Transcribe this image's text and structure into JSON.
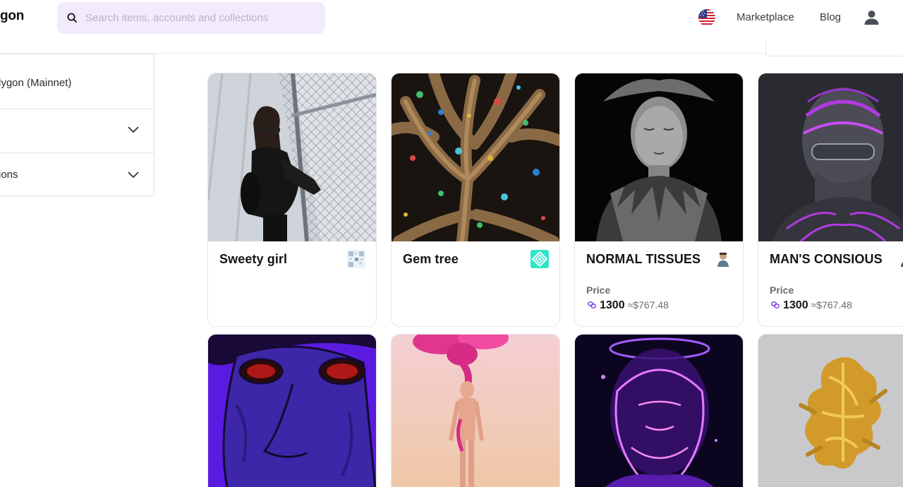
{
  "header": {
    "logo_text": "gon",
    "search_placeholder": "Search items, accounts and collections",
    "nav": {
      "marketplace": "Marketplace",
      "blog": "Blog"
    }
  },
  "sidebar": {
    "network_label": "lygon (Mainnet)",
    "row2_label": "",
    "row3_label": "ions"
  },
  "cards": [
    {
      "title": "Sweety girl",
      "price_label": "",
      "amount": "",
      "usd": ""
    },
    {
      "title": "Gem tree",
      "price_label": "",
      "amount": "",
      "usd": ""
    },
    {
      "title": "NORMAL TISSUES",
      "price_label": "Price",
      "amount": "1300",
      "usd": "≈$767.48"
    },
    {
      "title": "MAN'S CONSIOUS",
      "price_label": "Price",
      "amount": "1300",
      "usd": "≈$767.48"
    }
  ],
  "colors": {
    "search_bg": "#f1ebfd",
    "polygon_purple": "#8247e5",
    "border": "#e6e6e6"
  }
}
